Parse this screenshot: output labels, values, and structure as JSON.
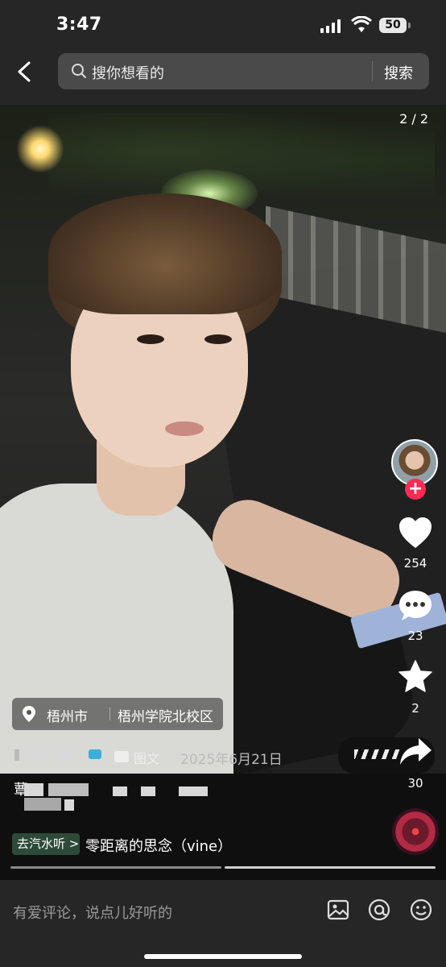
{
  "status_bar": {
    "time": "3:47",
    "battery": "50"
  },
  "header": {
    "search_placeholder": "搜你想看的",
    "search_button": "搜索"
  },
  "post": {
    "image_counter": "2 / 2",
    "location": {
      "city": "梧州市",
      "place": "梧州学院北校区"
    },
    "type_label": "图文",
    "date": "2025年6月21日",
    "author_fragment": "蕈"
  },
  "actions": {
    "likes": "254",
    "comments": "23",
    "favorites": "2",
    "shares": "30",
    "follow_symbol": "+"
  },
  "music": {
    "tag": "去汽水听 >",
    "title": "零距离的思念（vine）"
  },
  "progress": {
    "segments": 2,
    "current": 2
  },
  "comment_bar": {
    "placeholder": "有爱评论，说点儿好听的"
  },
  "colors": {
    "accent": "#fe2c55",
    "bar_bg": "#262626",
    "music_tag_bg": "#2d4a38"
  },
  "icons": [
    "back-arrow-icon",
    "search-icon",
    "heart-icon",
    "comment-icon",
    "star-icon",
    "share-icon",
    "location-pin-icon",
    "image-icon",
    "at-icon",
    "emoji-icon"
  ]
}
